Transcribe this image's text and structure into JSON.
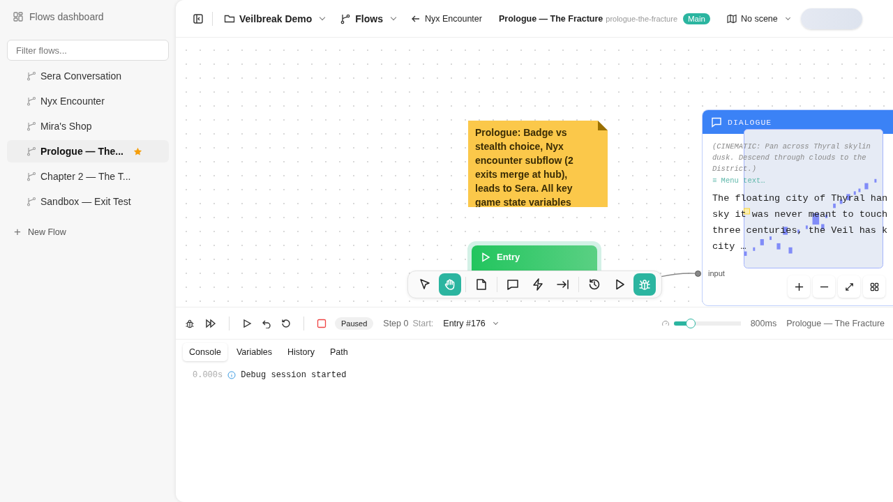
{
  "sidebar": {
    "title": "Flows dashboard",
    "filter": {
      "placeholder": "Filter flows..."
    },
    "flows": [
      {
        "label": "Sera Conversation",
        "selected": false,
        "starred": false
      },
      {
        "label": "Nyx Encounter",
        "selected": false,
        "starred": false
      },
      {
        "label": "Mira's Shop",
        "selected": false,
        "starred": false
      },
      {
        "label": "Prologue — The...",
        "selected": true,
        "starred": true
      },
      {
        "label": "Chapter 2 — The T...",
        "selected": false,
        "starred": false
      },
      {
        "label": "Sandbox — Exit Test",
        "selected": false,
        "starred": false
      }
    ],
    "new_flow": {
      "icon": "+",
      "label": "New Flow"
    }
  },
  "topbar": {
    "project": "Veilbreak Demo",
    "flows_menu": "Flows",
    "back": "Nyx Encounter",
    "flow_title": "Prologue — The Fracture",
    "flow_slug": "prologue-the-fracture",
    "badge": "Main",
    "scene": "No scene"
  },
  "canvas": {
    "note": "Prologue: Badge vs stealth choice, Nyx encounter subflow (2 exits merge at hub), leads to Sera. All key game state variables",
    "entry_node": {
      "label": "Entry"
    },
    "dialogue_node": {
      "header": "DIALOGUE",
      "stage_lines": [
        "(CINEMATIC: Pan across Thyral skylin",
        "dusk. Descend through clouds to the",
        "District.)"
      ],
      "menu_text": "≡ Menu text…",
      "text_lines": [
        "The floating city of Thyral han",
        "sky it was never meant to touch",
        "three centuries, the Veil has k",
        "city …"
      ],
      "input_label": "input"
    },
    "tools": [
      {
        "kind": "pointer",
        "selected": false
      },
      {
        "kind": "hand",
        "selected": true
      },
      {
        "kind": "note",
        "selected": false
      },
      {
        "kind": "dialogue",
        "selected": false
      },
      {
        "kind": "bolt",
        "selected": false
      },
      {
        "kind": "exit",
        "selected": false
      },
      {
        "kind": "history",
        "selected": false
      },
      {
        "kind": "play",
        "selected": false
      },
      {
        "kind": "debug",
        "selected": true
      }
    ]
  },
  "debug": {
    "status": "Paused",
    "step": "Step 0",
    "start_label": "Start:",
    "start_value": "Entry #176",
    "speed": {
      "level": 0.25
    },
    "speed_reading": "800ms",
    "flow_name": "Prologue — The Fracture",
    "tabs": [
      {
        "label": "Console",
        "selected": true
      },
      {
        "label": "Variables",
        "selected": false
      },
      {
        "label": "History",
        "selected": false
      },
      {
        "label": "Path",
        "selected": false
      }
    ],
    "log": [
      {
        "time": "0.000s",
        "message": "Debug session started"
      }
    ]
  }
}
